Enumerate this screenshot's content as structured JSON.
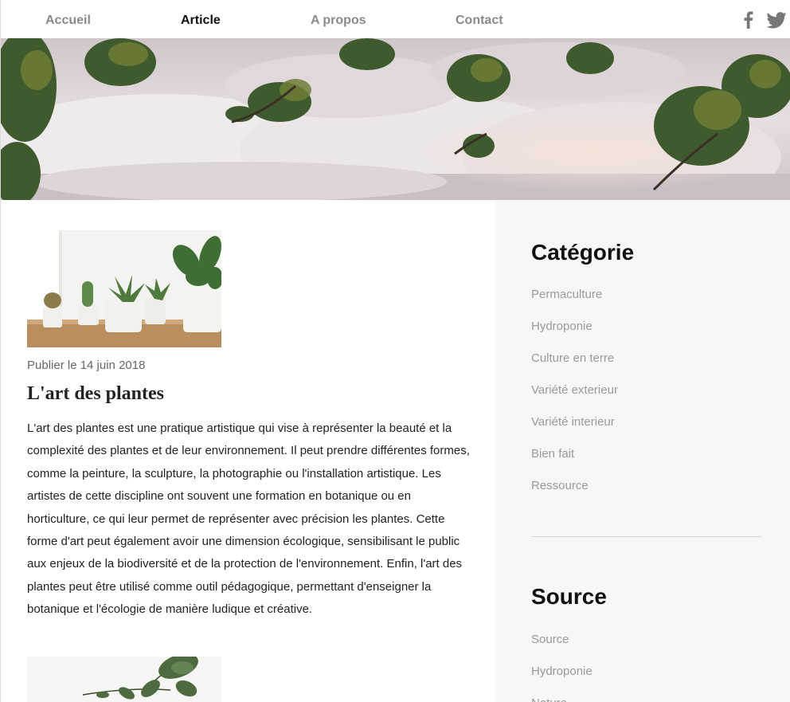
{
  "nav": {
    "items": [
      "Accueil",
      "Article",
      "A propos",
      "Contact"
    ],
    "active": "Article"
  },
  "social": {
    "icons": [
      "facebook-icon",
      "twitter-icon"
    ]
  },
  "article": {
    "date": "Publier le 14 juin 2018",
    "title": "L'art des plantes",
    "body": "L'art des plantes est une pratique artistique qui vise à représenter la beauté et la complexité des plantes et de leur environnement. Il peut prendre différentes formes, comme la peinture, la sculpture, la photographie ou l'installation artistique. Les artistes de cette discipline ont souvent une formation en botanique ou en horticulture, ce qui leur permet de représenter avec précision les plantes. Cette forme d'art peut également avoir une dimension écologique, sensibilisant le public aux enjeux de la biodiversité et de la protection de l'environnement. Enfin, l'art des plantes peut être utilisé comme outil pédagogique, permettant d'enseigner la botanique et l'écologie de manière ludique et créative."
  },
  "sidebar": {
    "category_title": "Catégorie",
    "categories": [
      "Permaculture",
      "Hydroponie",
      "Culture en terre",
      "Variété exterieur",
      "Variété interieur",
      "Bien fait",
      "Ressource"
    ],
    "source_title": "Source",
    "sources": [
      "Source",
      "Hydroponie",
      "Nature"
    ]
  },
  "colors": {
    "nav_inactive": "#8a8a8a",
    "nav_active": "#111111",
    "sidebar_bg": "#f7f7f7",
    "sidebar_link": "#9a9a9a"
  }
}
